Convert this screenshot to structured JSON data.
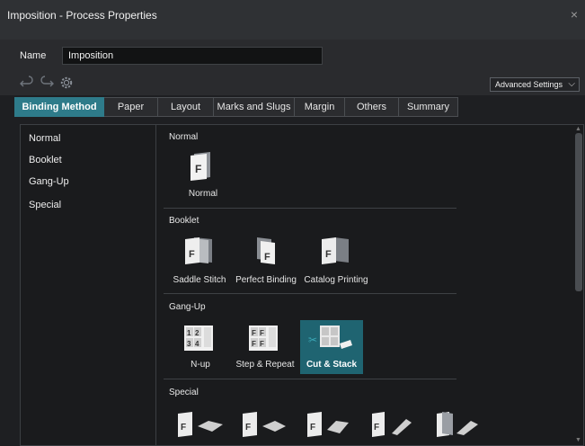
{
  "window": {
    "title": "Imposition - Process Properties",
    "close": "×"
  },
  "name_field": {
    "label": "Name",
    "value": "Imposition"
  },
  "toolbar": {
    "advanced_label": "Advanced Settings",
    "chev": "⌵"
  },
  "tabs": [
    {
      "label": "Binding Method",
      "active": true
    },
    {
      "label": "Paper"
    },
    {
      "label": "Layout"
    },
    {
      "label": "Marks and Slugs"
    },
    {
      "label": "Margin"
    },
    {
      "label": "Others"
    },
    {
      "label": "Summary"
    }
  ],
  "left_list": [
    "Normal",
    "Booklet",
    "Gang-Up",
    "Special"
  ],
  "sections": {
    "normal": {
      "title": "Normal",
      "options": [
        "Normal"
      ]
    },
    "booklet": {
      "title": "Booklet",
      "options": [
        "Saddle Stitch",
        "Perfect Binding",
        "Catalog Printing"
      ]
    },
    "gangup": {
      "title": "Gang-Up",
      "options": [
        "N-up",
        "Step & Repeat",
        "Cut & Stack"
      ],
      "selected": "Cut & Stack"
    },
    "special": {
      "title": "Special"
    }
  },
  "icons": {
    "undo": "undo-icon",
    "redo": "redo-icon",
    "settings": "gear-icon",
    "page_letter": "F",
    "nup_digits": [
      "1",
      "2",
      "3",
      "4"
    ],
    "cut_tag": "✂"
  },
  "colors": {
    "accent": "#2e7b8a",
    "selected_bg": "#1f6471",
    "background": "#1a1b1d"
  }
}
